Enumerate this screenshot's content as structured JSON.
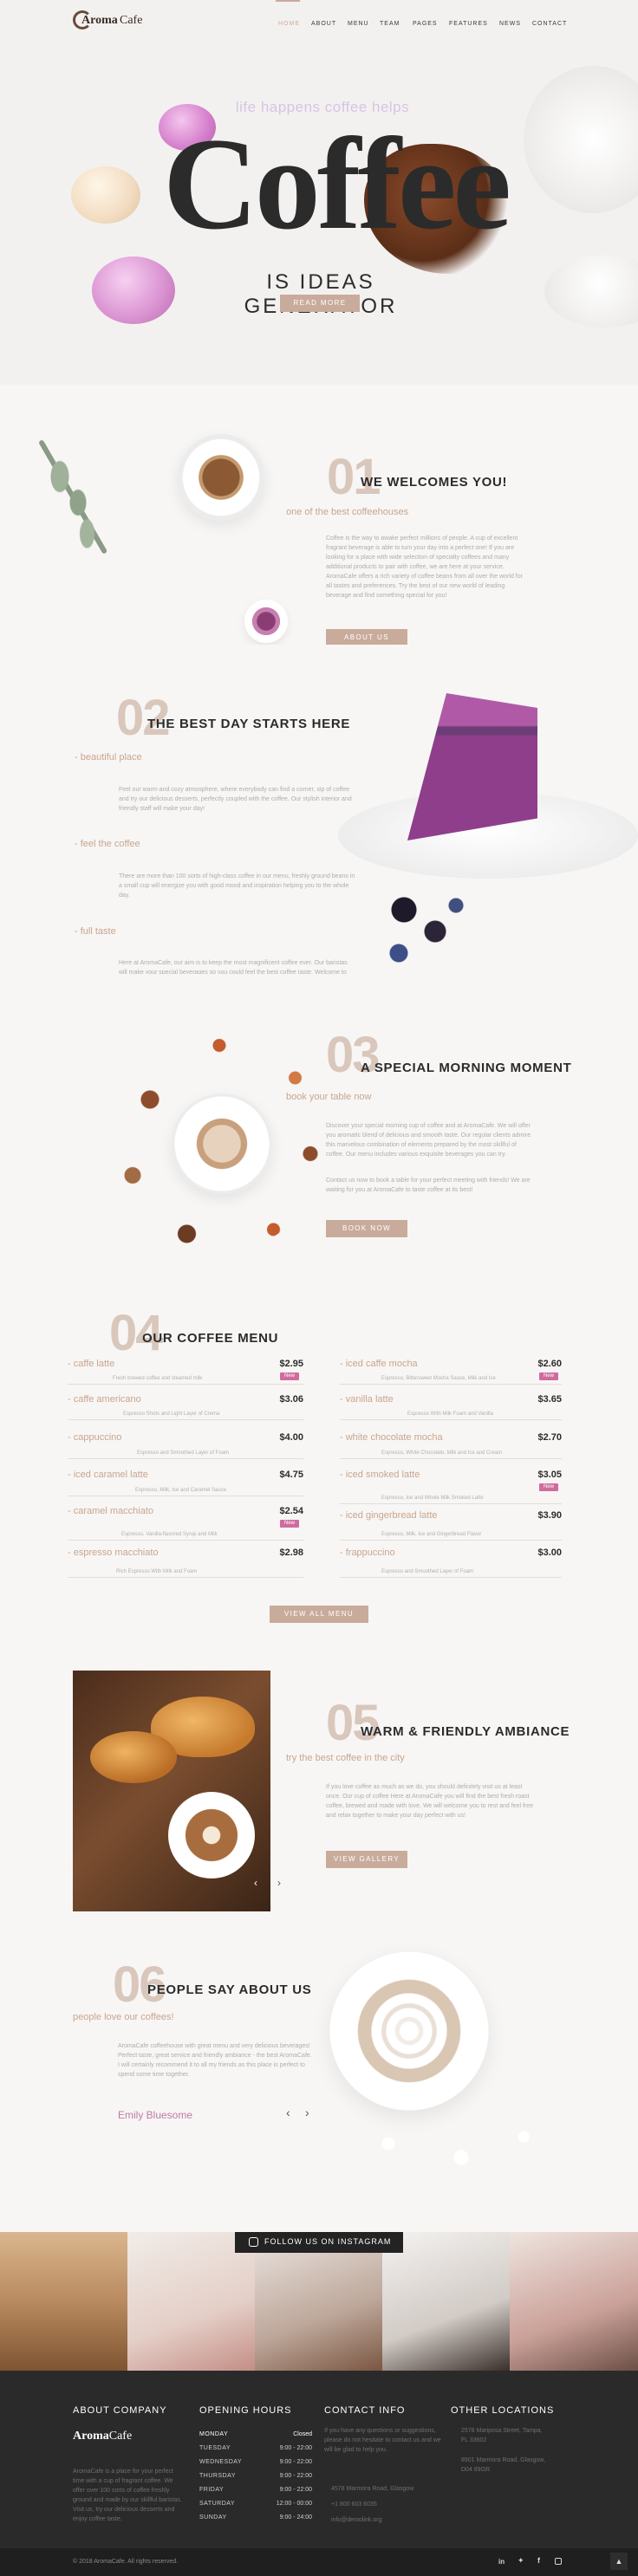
{
  "brand": {
    "name_a": "Aroma",
    "name_b": "Cafe"
  },
  "nav": [
    "Home",
    "About",
    "Menu",
    "Team",
    "Pages",
    "Features",
    "News",
    "Contact"
  ],
  "hero": {
    "tagline": "life happens coffee helps",
    "title": "Coffee",
    "subtitle": "IS IDEAS GENERATOR",
    "button": "Read More"
  },
  "s1": {
    "num": "01",
    "title": "WE WELCOMES YOU!",
    "sub": "one of the best coffeehouses",
    "para": "Coffee is the way to awake perfect millions of people. A cup of excellent fragrant beverage is able to turn your day into a perfect one! If you are looking for a place with wide selection of specialty coffees and many additional products to pair with coffee, we are here at your service. AromaCafe offers a rich variety of coffee beans from all over the world for all tastes and preferences. Try the best of our new world of leading beverage and find something special for you!",
    "button": "About Us"
  },
  "s2": {
    "num": "02",
    "title": "THE BEST DAY STARTS HERE",
    "items": [
      {
        "label": "- beautiful place",
        "text": "Feel our warm and cozy atmosphere, where everybody can find a corner, sip of coffee and try our delicious desserts, perfectly coupled with the coffee. Our stylish interior and friendly staff will make your day!"
      },
      {
        "label": "- feel the coffee",
        "text": "There are more than 100 sorts of high-class coffee in our menu, freshly ground beans in a small cup will energize you with good mood and inspiration helping you to the whole day."
      },
      {
        "label": "- full taste",
        "text": "Here at AromaCafe, our aim is to keep the most magnificent coffee ever. Our baristas will make your special beverages so you could feel the best coffee taste. Welcome to AromaCafe to have your cup of coffee!"
      }
    ]
  },
  "s3": {
    "num": "03",
    "title": "A SPECIAL MORNING MOMENT",
    "sub": "book your table now",
    "para1": "Discover your special morning cup of coffee and at AromaCafe. We will offer you aromatic blend of delicious and smooth taste. Our regular clients admire this marvelous combination of elements prepared by the most skillful of coffee. Our menu includes various exquisite beverages you can try.",
    "para2": "Contact us now to book a table for your perfect meeting with friends! We are waiting for you at AromaCafe to taste coffee at its best!",
    "button": "Book Now"
  },
  "s4": {
    "num": "04",
    "title": "OUR COFFEE MENU",
    "button": "View All Menu",
    "left": [
      {
        "name": "- caffe latte",
        "price": "$2.95",
        "desc": "Fresh brewed coffee and steamed milk",
        "badge": "New"
      },
      {
        "name": "- caffe americano",
        "price": "$3.06",
        "desc": "Espresso Shots and Light Layer of Crema",
        "badge": ""
      },
      {
        "name": "- cappuccino",
        "price": "$4.00",
        "desc": "Espresso and Smoothed Layer of Foam",
        "badge": ""
      },
      {
        "name": "- iced caramel latte",
        "price": "$4.75",
        "desc": "Espresso, Milk, Ice and Caramel Sauce",
        "badge": ""
      },
      {
        "name": "- caramel macchiato",
        "price": "$2.54",
        "desc": "Espresso, Vanilla-flavored Syrup and Milk",
        "badge": "New"
      },
      {
        "name": "- espresso macchiato",
        "price": "$2.98",
        "desc": "Rich Espresso With Milk and Foam",
        "badge": ""
      }
    ],
    "right": [
      {
        "name": "- iced caffe mocha",
        "price": "$2.60",
        "desc": "Espresso, Bittersweet Mocha Sauce, Milk and Ice",
        "badge": "New"
      },
      {
        "name": "- vanilla latte",
        "price": "$3.65",
        "desc": "Espresso With Milk Foam and Vanilla",
        "badge": ""
      },
      {
        "name": "- white chocolate mocha",
        "price": "$2.70",
        "desc": "Espresso, White Chocolate, Milk and Ice and Cream",
        "badge": ""
      },
      {
        "name": "- iced smoked latte",
        "price": "$3.05",
        "desc": "Espresso, Ice and Whole Milk Smoked Latte",
        "badge": "New"
      },
      {
        "name": "- iced gingerbread latte",
        "price": "$3.90",
        "desc": "Espresso, Milk, Ice and Gingerbread Flavor",
        "badge": ""
      },
      {
        "name": "- frappuccino",
        "price": "$3.00",
        "desc": "Espresso and Smoothed Layer of Foam",
        "badge": ""
      }
    ]
  },
  "s5": {
    "num": "05",
    "title": "WARM & FRIENDLY AMBIANCE",
    "sub": "try the best coffee in the city",
    "para": "If you love coffee as much as we do, you should definitely visit us at least once. Our cup of coffee Here at AromaCafe you will find the best fresh roast coffee, brewed and made with love. We will welcome you to rest and feel free and relax together to make your day perfect with us!",
    "button": "View Gallery"
  },
  "s6": {
    "num": "06",
    "title": "PEOPLE SAY ABOUT US",
    "sub": "people love our coffees!",
    "para": "AromaCafe coffeehouse with great menu and very delicious beverages! Perfect taste, great service and friendly ambiance - the best AromaCafe. I will certainly recommend it to all my friends as this place is perfect to spend some time together.",
    "author": "Emily Bluesome"
  },
  "instagram": {
    "label": "FOLLOW US ON INSTAGRAM"
  },
  "footer": {
    "about_h": "About Company",
    "about_text": "AromaCafe is a place for your perfect time with a cup of fragrant coffee. We offer over 100 sorts of coffee freshly ground and made by our skillful baristas. Visit us, try our delicious desserts and enjoy coffee taste.",
    "hours_h": "Opening Hours",
    "hours": [
      {
        "day": "Monday",
        "time": "Closed"
      },
      {
        "day": "Tuesday",
        "time": "9:00 - 22:00"
      },
      {
        "day": "Wednesday",
        "time": "9:00 - 22:00"
      },
      {
        "day": "Thursday",
        "time": "9:00 - 22:00"
      },
      {
        "day": "Friday",
        "time": "9:00 - 22:00"
      },
      {
        "day": "Saturday",
        "time": "12:00 - 00:00"
      },
      {
        "day": "Sunday",
        "time": "9:00 - 24:00"
      }
    ],
    "contact_h": "Contact Info",
    "contact_text": "If you have any questions or suggestions, please do not hesitate to contact us and we will be glad to help you.",
    "contact_address": "4578 Marmora Road, Glasgow",
    "contact_phone": "+1 800 603 6035",
    "contact_email": "info@demolink.org",
    "other_h": "Other Locations",
    "locations": [
      "2578 Mariposa Street, Tampa, FL 33602",
      "8901 Marmora Road, Glasgow, D04 89GR"
    ],
    "copyright": "© 2018 AromaCafe. All rights reserved."
  },
  "colors": {
    "accent": "#c9ab9b",
    "dark": "#232323",
    "pink": "#cf6c9d",
    "bg": "#f3f1f0"
  }
}
